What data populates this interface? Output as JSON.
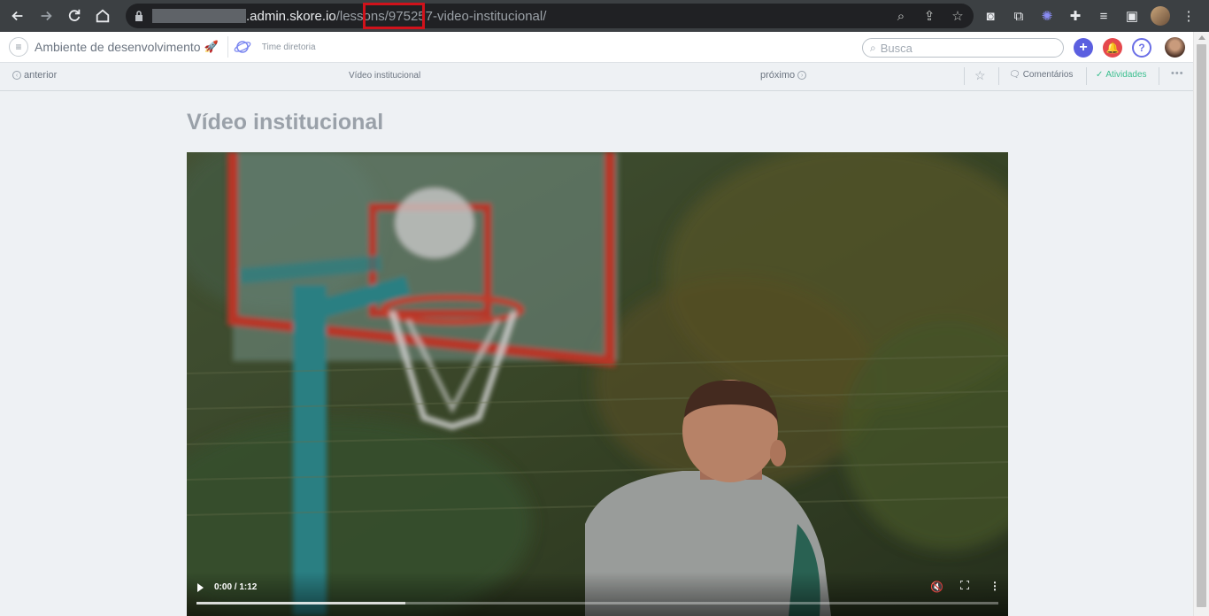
{
  "browser": {
    "url_host": ".admin.skore.io",
    "url_path_before": "/lessons/",
    "url_path_id": "975257-",
    "url_path_after": "video-institucional/"
  },
  "header": {
    "env_label": "Ambiente de desenvolvimento",
    "env_emoji": "🚀",
    "team_label": "Time diretoria",
    "search_placeholder": "Busca",
    "add_label": "+",
    "help_label": "?"
  },
  "lessonbar": {
    "prev_label": "anterior",
    "title": "Vídeo institucional",
    "next_label": "próximo",
    "comments_label": "Comentários",
    "activities_label": "Atividades"
  },
  "main": {
    "page_title": "Vídeo institucional"
  },
  "video": {
    "time": "0:00 / 1:12",
    "buffered_fraction": 0.26
  }
}
